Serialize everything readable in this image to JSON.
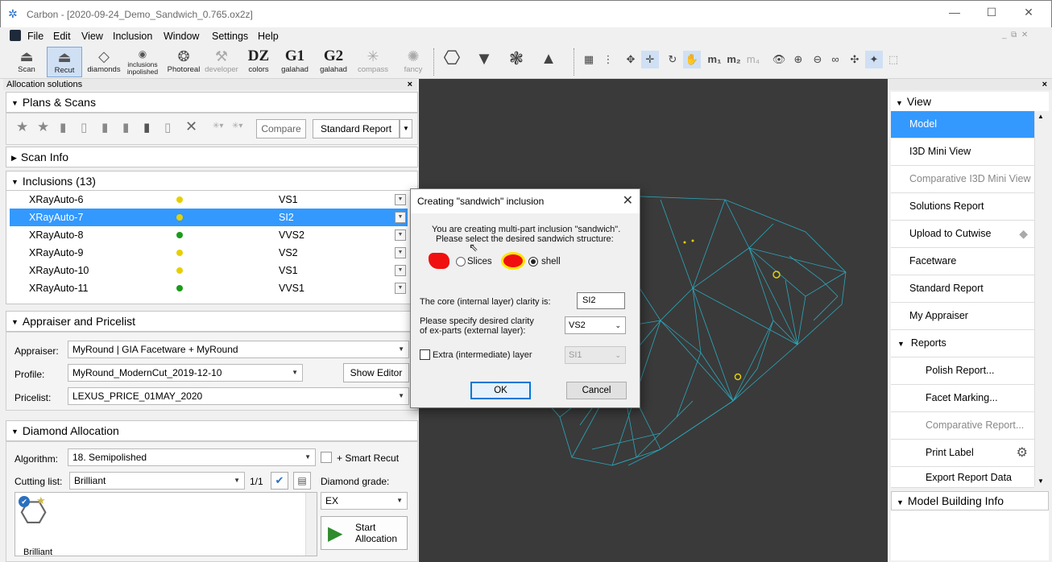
{
  "window": {
    "title": "Carbon - [2020-09-24_Demo_Sandwich_0.765.ox2z]"
  },
  "menu": [
    "File",
    "Edit",
    "View",
    "Inclusion",
    "Window",
    "Settings",
    "Help"
  ],
  "toolbar": {
    "scan": "Scan",
    "recut": "Recut",
    "diamonds": "diamonds",
    "inclusions_1": "inclusions",
    "inclusions_2": "inpolished",
    "photoreal": "Photoreal",
    "developer": "developer",
    "dz_big": "DZ",
    "dz_small": "colors",
    "g1_big": "G1",
    "g1_small": "galahad",
    "g2_big": "G2",
    "g2_small": "galahad",
    "compass": "compass",
    "fancy": "fancy"
  },
  "left_panel": {
    "title": "Allocation solutions",
    "plans": {
      "title": "Plans & Scans",
      "compare": "Compare",
      "standard_report": "Standard Report"
    },
    "scan_info": {
      "title": "Scan Info"
    },
    "inclusions": {
      "title": "Inclusions (13)",
      "rows": [
        {
          "name": "XRayAuto-6",
          "dot": "#e6d000",
          "clarity": "VS1"
        },
        {
          "name": "XRayAuto-7",
          "dot": "#e6d000",
          "clarity": "SI2"
        },
        {
          "name": "XRayAuto-8",
          "dot": "#1a9c1a",
          "clarity": "VVS2"
        },
        {
          "name": "XRayAuto-9",
          "dot": "#e6d000",
          "clarity": "VS2"
        },
        {
          "name": "XRayAuto-10",
          "dot": "#e6d000",
          "clarity": "VS1"
        },
        {
          "name": "XRayAuto-11",
          "dot": "#1a9c1a",
          "clarity": "VVS1"
        }
      ]
    },
    "appraiser": {
      "title": "Appraiser and Pricelist",
      "appraiser_label": "Appraiser:",
      "appraiser_value": "MyRound | GIA Facetware + MyRound",
      "profile_label": "Profile:",
      "profile_value": "MyRound_ModernCut_2019-12-10",
      "show_editor": "Show Editor",
      "pricelist_label": "Pricelist:",
      "pricelist_value": "LEXUS_PRICE_01MAY_2020"
    },
    "allocation": {
      "title": "Diamond Allocation",
      "algorithm_label": "Algorithm:",
      "algorithm_value": "18. Semipolished",
      "smart_recut": "+ Smart Recut",
      "cutting_label": "Cutting list:",
      "cutting_value": "Brilliant",
      "page": "1/1",
      "grade_label": "Diamond grade:",
      "grade_value": "EX",
      "start_1": "Start",
      "start_2": "Allocation",
      "thumb_label": "Brilliant"
    }
  },
  "dialog": {
    "title": "Creating \"sandwich\" inclusion",
    "line1": "You are creating multi-part inclusion \"sandwich\".",
    "line2": "Please select the desired sandwich structure:",
    "opt_slices": "Slices",
    "opt_shell": "shell",
    "core_label": "The core (internal layer) clarity is:",
    "core_value": "SI2",
    "ex_label_1": "Please specify desired clarity",
    "ex_label_2": "of ex-parts (external layer):",
    "ex_value": "VS2",
    "extra_label": "Extra (intermediate) layer",
    "extra_value": "SI1",
    "ok": "OK",
    "cancel": "Cancel"
  },
  "right_panel": {
    "view_title": "View",
    "items": [
      "Model",
      "I3D Mini View",
      "Comparative I3D Mini View",
      "Solutions Report",
      "Upload to Cutwise",
      "Facetware",
      "Standard Report",
      "My Appraiser"
    ],
    "reports_title": "Reports",
    "reports": [
      "Polish Report...",
      "Facet Marking...",
      "Comparative Report...",
      "Print Label",
      "Export Report Data"
    ],
    "model_building": "Model Building Info"
  },
  "colors": {
    "selection": "#3399ff",
    "wireframe": "#2ab3c9",
    "viewport_bg": "#3a3a3a"
  }
}
